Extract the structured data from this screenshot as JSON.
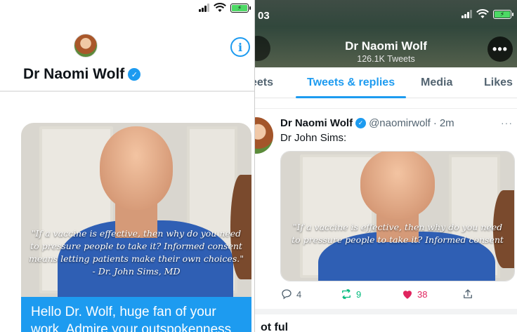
{
  "left_panel": {
    "dm_header": {
      "name": "Dr Naomi Wolf",
      "info_icon_glyph": "i"
    },
    "image_quote": "\"If a vaccine is effective, then why do you need to pressure people to take it? Informed consent means letting patients make their own choices.\" - Dr. John Sims, MD",
    "message_bubble": "Hello Dr. Wolf, huge fan of your work. Admire your outspokenness"
  },
  "right_panel": {
    "status_time": "03",
    "profile_header": {
      "name": "Dr Naomi Wolf",
      "tweet_count": "126.1K Tweets",
      "more_glyph": "•••"
    },
    "tabs": [
      {
        "label": "eets"
      },
      {
        "label": "Tweets & replies"
      },
      {
        "label": "Media"
      },
      {
        "label": "Likes"
      }
    ],
    "tweet": {
      "name": "Dr Naomi Wolf",
      "handle": "@naomirwolf",
      "separator": "·",
      "time": "2m",
      "more_glyph": "···",
      "text": "Dr John Sims:",
      "image_quote": "\"If a vaccine is effective, then why do you need to pressure people to take it? Informed consent",
      "reply_count": "4",
      "retweet_count": "9",
      "like_count": "38"
    },
    "next_text": "ot ful"
  },
  "colors": {
    "accent": "#1d9bf0",
    "retweet": "#00ba7c",
    "like": "#e0245e"
  },
  "icons": [
    "signal-icon",
    "wifi-icon",
    "battery-charging-icon",
    "info-icon",
    "verified-badge-icon",
    "more-icon",
    "reply-icon",
    "retweet-icon",
    "like-icon",
    "share-icon"
  ]
}
